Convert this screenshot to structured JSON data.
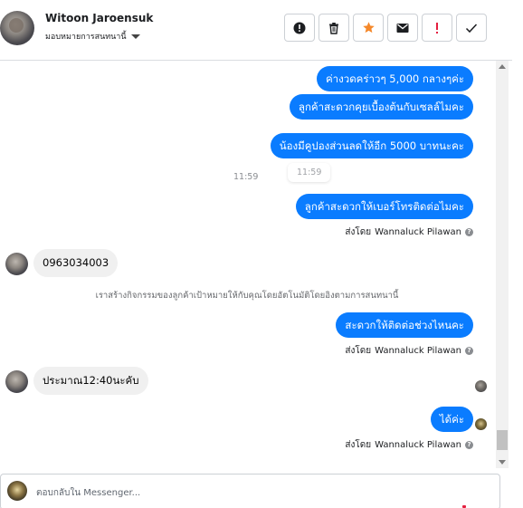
{
  "header": {
    "contact_name": "Witoon Jaroensuk",
    "assign_label": "มอบหมายการสนทนานี้",
    "actions": [
      {
        "name": "report-icon",
        "label": "!"
      },
      {
        "name": "trash-icon",
        "label": ""
      },
      {
        "name": "star-icon",
        "label": ""
      },
      {
        "name": "envelope-icon",
        "label": ""
      },
      {
        "name": "priority-icon",
        "label": "!"
      },
      {
        "name": "checkmark-icon",
        "label": ""
      }
    ]
  },
  "messages": {
    "out1": "ค่างวดคร่าวๆ  5,000  กลางๆค่ะ",
    "out2": "ลูกค้าสะดวกคุยเบื้องต้นกับเซลล์ไมคะ",
    "out3": "น้องมีคูปองส่วนลดให้อีก 5000 บาทนะคะ",
    "time1": "11:59",
    "time_tip": "11:59",
    "out4": "ลูกค้าสะดวกให้เบอร์โทรติดต่อไมคะ",
    "sent_by_prefix": "ส่งโดย",
    "sender": "Wannaluck Pilawan",
    "in1": "0963034003",
    "system_note": "เราสร้างกิจกรรมของลูกค้าเป้าหมายให้กับคุณโดยอัตโนมัติโดยอิงตามการสนทนานี้",
    "out5": "สะดวกให้ติดต่อช่วงไหนคะ",
    "in2": "ประมาณ12:40นะคับ",
    "out6": "ได้ค่ะ"
  },
  "reply": {
    "placeholder": "ตอบกลับใน Messenger..."
  },
  "colors": {
    "outgoing_bubble": "#0a7cff",
    "incoming_bubble": "#f0f0f0",
    "star": "#f5882a",
    "priority": "#e41e3f"
  }
}
